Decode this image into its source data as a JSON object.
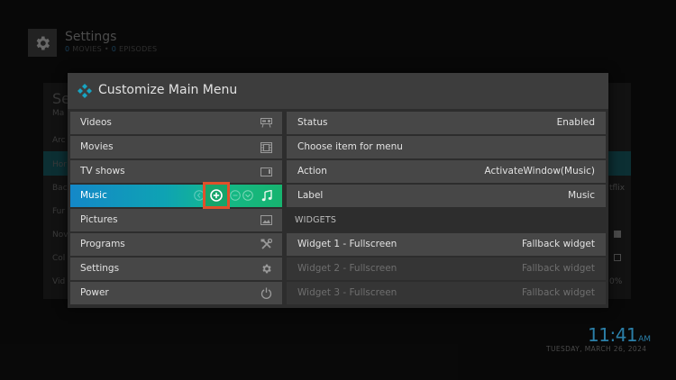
{
  "background": {
    "header": {
      "title": "Settings",
      "movies_count": "0",
      "movies_label": "MOVIES",
      "separator": "•",
      "episodes_count": "0",
      "episodes_label": "EPISODES"
    },
    "panel": {
      "heading_partial": "Se",
      "heading_sub_partial": "Ma",
      "side_items": [
        "Arc",
        "Hor",
        "Bac",
        "Fur",
        "Nov",
        "Col",
        "Vid"
      ],
      "right_texts": [
        "tflix",
        "0%"
      ]
    },
    "clock": {
      "time": "11:41",
      "ampm": "AM",
      "date": "TUESDAY, MARCH 26, 2024"
    }
  },
  "dialog": {
    "title": "Customize Main Menu",
    "menu_items": [
      {
        "label": "Videos",
        "icon": "projector-icon"
      },
      {
        "label": "Movies",
        "icon": "film-icon"
      },
      {
        "label": "TV shows",
        "icon": "tv-icon"
      },
      {
        "label": "Music",
        "icon": "music-note-icon",
        "active": true
      },
      {
        "label": "Pictures",
        "icon": "picture-icon"
      },
      {
        "label": "Programs",
        "icon": "tools-icon"
      },
      {
        "label": "Settings",
        "icon": "gear-icon"
      },
      {
        "label": "Power",
        "icon": "power-icon"
      }
    ],
    "properties": [
      {
        "key": "Status",
        "value": "Enabled"
      },
      {
        "key": "Choose item for menu",
        "value": ""
      },
      {
        "key": "Action",
        "value": "ActivateWindow(Music)"
      },
      {
        "key": "Label",
        "value": "Music"
      }
    ],
    "widgets_header": "WIDGETS",
    "widgets": [
      {
        "key": "Widget 1 - Fullscreen",
        "value": "Fallback widget"
      },
      {
        "key": "Widget 2 - Fullscreen",
        "value": "Fallback widget"
      },
      {
        "key": "Widget 3 - Fullscreen",
        "value": "Fallback widget"
      }
    ]
  },
  "colors": {
    "accent_blue": "#1488c8",
    "accent_green": "#17b46f",
    "highlight_box": "#e0502a"
  }
}
